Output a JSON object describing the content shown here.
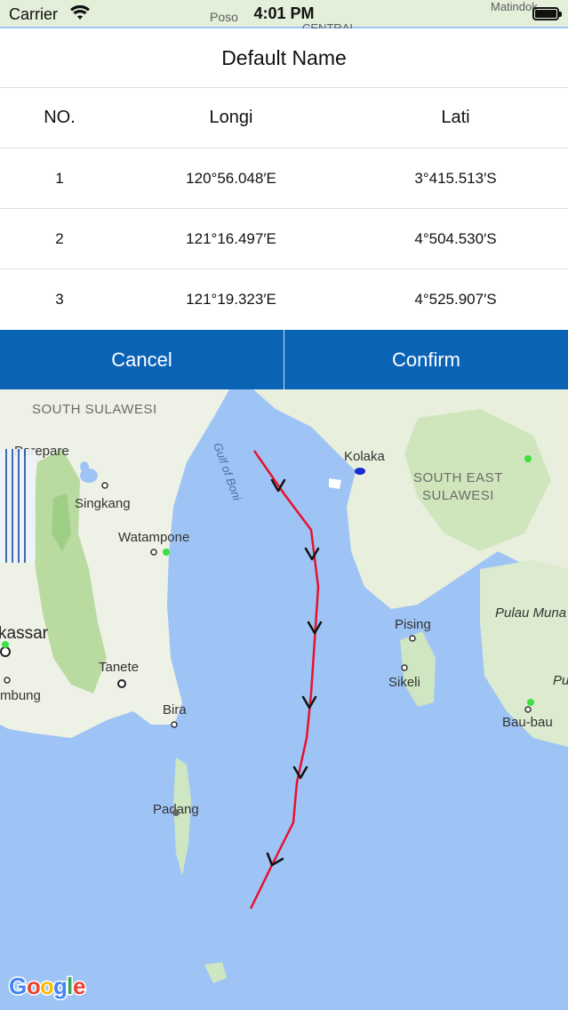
{
  "status_bar": {
    "carrier": "Carrier",
    "time": "4:01 PM"
  },
  "dialog": {
    "title": "Default Name",
    "columns": [
      "NO.",
      "Longi",
      "Lati"
    ],
    "rows": [
      {
        "no": "1",
        "longi": "120°56.048′E",
        "lati": "3°415.513′S"
      },
      {
        "no": "2",
        "longi": "121°16.497′E",
        "lati": "4°504.530′S"
      },
      {
        "no": "3",
        "longi": "121°19.323′E",
        "lati": "4°525.907′S"
      }
    ],
    "cancel_label": "Cancel",
    "confirm_label": "Confirm",
    "accent_color": "#0b63b6"
  },
  "map": {
    "top_labels": {
      "poso": "Poso",
      "central": "CENTRAL",
      "matindok": "Matindok"
    },
    "labels": {
      "south_sulawesi": "SOUTH SULAWESI",
      "parepare": "Parepare",
      "singkang": "Singkang",
      "watampone": "Watampone",
      "makassar": "kassar",
      "bulukumba": "mbung",
      "tanete": "Tanete",
      "bira": "Bira",
      "padang": "Padang",
      "gulf": "Gulf of Boni",
      "kolaka": "Kolaka",
      "south_east_1": "SOUTH EAST",
      "south_east_2": "SULAWESI",
      "pising": "Pising",
      "sikeli": "Sikeli",
      "pulau_muna": "Pulau Muna",
      "pu": "Pu",
      "bau_bau": "Bau-bau"
    },
    "google_logo": "Google",
    "route_color": "#e8112d"
  }
}
